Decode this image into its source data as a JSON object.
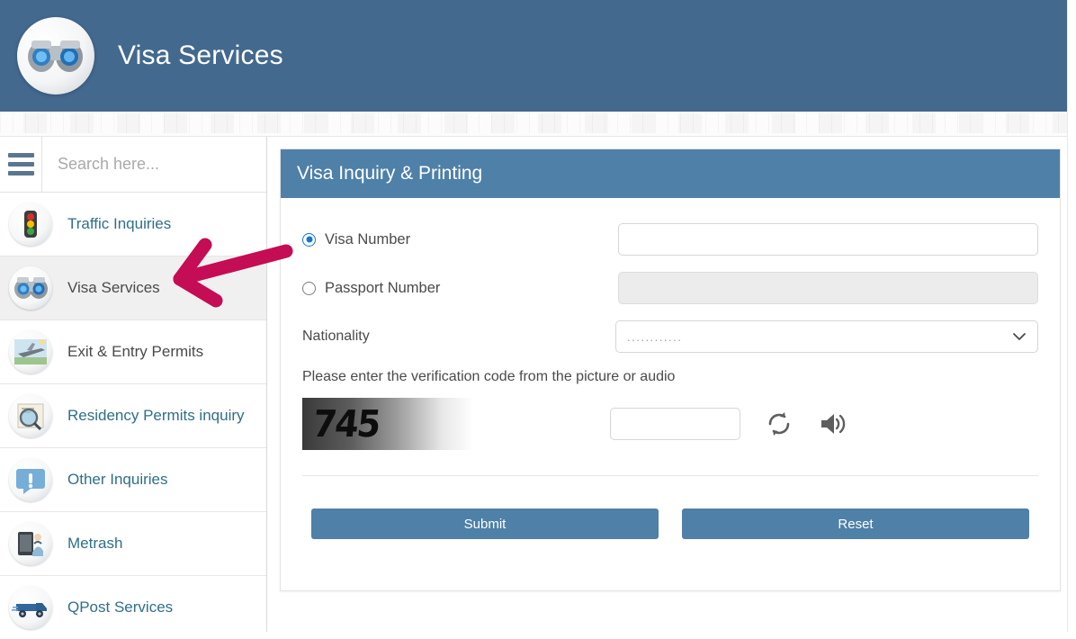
{
  "header": {
    "title": "Visa Services",
    "logo_icon": "binoculars-icon",
    "bg_color": "#43698E"
  },
  "sidebar": {
    "menu_icon": "hamburger-icon",
    "search": {
      "placeholder": "Search here...",
      "value": ""
    },
    "items": [
      {
        "label": "Traffic Inquiries",
        "icon": "traffic-light-icon",
        "active": false
      },
      {
        "label": "Visa Services",
        "icon": "binoculars-icon",
        "active": true
      },
      {
        "label": "Exit & Entry Permits",
        "icon": "airplane-icon",
        "active": false
      },
      {
        "label": "Residency Permits inquiry",
        "icon": "magnifier-document-icon",
        "active": false
      },
      {
        "label": "Other Inquiries",
        "icon": "exclamation-bubble-icon",
        "active": false
      },
      {
        "label": "Metrash",
        "icon": "mobile-person-icon",
        "active": false
      },
      {
        "label": "QPost Services",
        "icon": "delivery-van-icon",
        "active": false
      }
    ]
  },
  "card": {
    "title": "Visa Inquiry & Printing",
    "header_color": "#4E80A8",
    "fields": {
      "visa_number_label": "Visa Number",
      "visa_number_value": "",
      "passport_number_label": "Passport Number",
      "passport_number_value": "",
      "nationality_label": "Nationality",
      "nationality_value": "............",
      "selected_option": "visa_number"
    },
    "captcha": {
      "hint": "Please enter the verification code from the picture or audio",
      "code": "745",
      "input_value": "",
      "refresh_icon": "refresh-icon",
      "audio_icon": "speaker-icon"
    },
    "buttons": {
      "submit": "Submit",
      "reset": "Reset"
    }
  },
  "annotation": {
    "arrow_color": "#C40D55",
    "points_to": "Visa Services"
  }
}
